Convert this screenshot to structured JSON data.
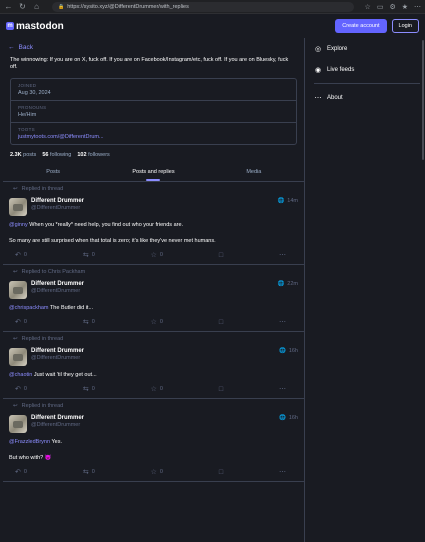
{
  "browser": {
    "url": "https://sysito.xyz/@DifferentDrummer/with_replies"
  },
  "header": {
    "logo_text": "mastodon",
    "create_account_label": "Create account",
    "login_label": "Login"
  },
  "nav": {
    "back_label": "Back"
  },
  "profile": {
    "bio": "The winnowing: If you are on X, fuck off. If you are on Facebook/Instagram/etc, fuck off. If you are on Bluesky, fuck off.",
    "fields": [
      {
        "key": "JOINED",
        "value": "Aug 30, 2024"
      },
      {
        "key": "PRONOUNS",
        "value": "He/Him"
      },
      {
        "key": "TOOTS",
        "value": "justmytoots.com/@DifferentDrum..."
      }
    ],
    "counts": {
      "posts_num": "2.3K",
      "posts_label": "posts",
      "following_num": "56",
      "following_label": "following",
      "followers_num": "102",
      "followers_label": "followers"
    }
  },
  "tabs": [
    "Posts",
    "Posts and replies",
    "Media"
  ],
  "posts": [
    {
      "context": "Replied in thread",
      "display_name": "Different Drummer",
      "acct": "@DifferentDrummer",
      "time": "14m",
      "mention": "@ginny",
      "text1": " When you *really* need help, you find out who your friends are.",
      "text2": "So many are still surprised when that total is zero; it's like they've never met humans.",
      "replies": "0",
      "boosts": "0",
      "favs": "0"
    },
    {
      "context": "Replied to Chris Packham",
      "display_name": "Different Drummer",
      "acct": "@DifferentDrummer",
      "time": "22m",
      "mention": "@chrispackham",
      "text1": " The Butler did it...",
      "replies": "0",
      "boosts": "0",
      "favs": "0"
    },
    {
      "context": "Replied in thread",
      "display_name": "Different Drummer",
      "acct": "@DifferentDrummer",
      "time": "16h",
      "mention": "@chaotin",
      "text1": " Just wait 'til they get out...",
      "replies": "0",
      "boosts": "0",
      "favs": "0"
    },
    {
      "context": "Replied in thread",
      "display_name": "Different Drummer",
      "acct": "@DifferentDrummer",
      "time": "16h",
      "mention": "@FrazzledBrynn",
      "text1": " Yes.",
      "text2": "But who with? 😈",
      "replies": "0",
      "boosts": "0",
      "favs": "0"
    }
  ],
  "sidebar": {
    "items": [
      {
        "label": "Explore",
        "icon": "hashtag-icon"
      },
      {
        "label": "Live feeds",
        "icon": "globe-icon"
      },
      {
        "label": "About",
        "icon": "ellipsis-icon"
      }
    ]
  },
  "colors": {
    "accent": "#6364ff",
    "link": "#8c8dff",
    "background": "#191b22",
    "muted": "#606984"
  }
}
